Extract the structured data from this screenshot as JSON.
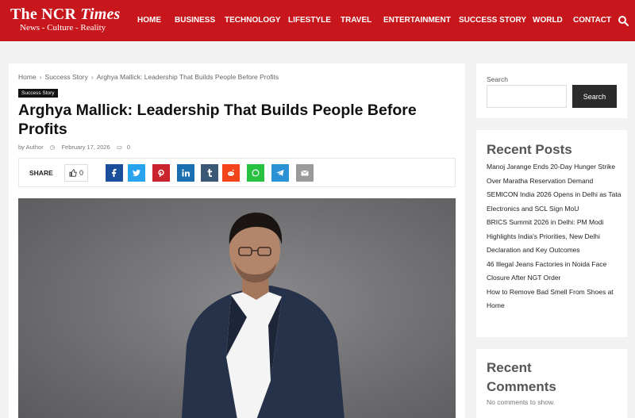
{
  "site": {
    "name_regular": "The NCR ",
    "name_italic": "Times",
    "tagline": "News - Culture - Reality"
  },
  "nav": {
    "items": [
      {
        "label": "HOME"
      },
      {
        "label": "BUSINESS"
      },
      {
        "label": "TECHNOLOGY"
      },
      {
        "label": "LIFESTYLE"
      },
      {
        "label": "TRAVEL"
      },
      {
        "label": "ENTERTAINMENT"
      },
      {
        "label": "SUCCESS STORY"
      },
      {
        "label": "WORLD"
      },
      {
        "label": "CONTACT"
      }
    ],
    "search_icon": "search-icon"
  },
  "breadcrumb": {
    "home": "Home",
    "category": "Success Story",
    "current": "Arghya Mallick: Leadership That Builds People Before Profits",
    "separator": "›"
  },
  "post": {
    "category_badge": "Success Story",
    "title": "Arghya Mallick: Leadership That Builds People Before Profits",
    "author": "by Author",
    "date": "February 17, 2026",
    "comments_count": "0"
  },
  "share": {
    "label": "SHARE",
    "likes": "0",
    "buttons": [
      {
        "name": "facebook",
        "color": "#1b4f9c"
      },
      {
        "name": "twitter",
        "color": "#2aa3ef"
      },
      {
        "name": "pinterest",
        "color": "#c9232d"
      },
      {
        "name": "linkedin",
        "color": "#1a6fb0"
      },
      {
        "name": "tumblr",
        "color": "#3a5776"
      },
      {
        "name": "reddit",
        "color": "#f2431a"
      },
      {
        "name": "whatsapp",
        "color": "#25c13f"
      },
      {
        "name": "telegram",
        "color": "#2a91d4"
      },
      {
        "name": "email",
        "color": "#9a9a9a"
      }
    ]
  },
  "sidebar": {
    "search": {
      "label": "Search",
      "placeholder": "",
      "button": "Search"
    },
    "recent_posts": {
      "title": "Recent Posts",
      "items": [
        "Manoj Jarange Ends 20-Day Hunger Strike Over Maratha Reservation Demand",
        "SEMICON India 2026 Opens in Delhi as Tata Electronics and SCL Sign MoU",
        "BRICS Summit 2026 in Delhi: PM Modi Highlights India's Priorities, New Delhi Declaration and Key Outcomes",
        "46 Illegal Jeans Factories in Noida Face Closure After NGT Order",
        "How to Remove Bad Smell From Shoes at Home"
      ]
    },
    "recent_comments": {
      "title": "Recent Comments",
      "empty_text": "No comments to show."
    }
  },
  "colors": {
    "header_bg": "#c8161d",
    "page_bg": "#f2f2f2",
    "search_button_bg": "#2b2b2b"
  }
}
